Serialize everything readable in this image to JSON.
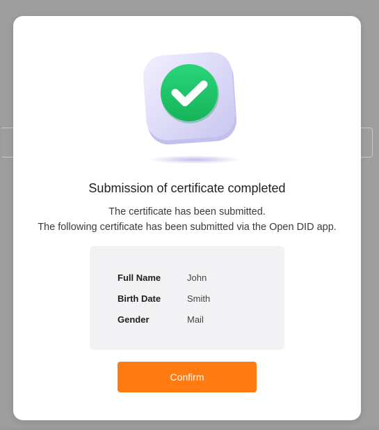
{
  "dialog": {
    "title": "Submission of certificate completed",
    "message_line1": "The certificate has been submitted.",
    "message_line2": "The following certificate has been submitted via the Open DID app.",
    "illustration_icon": "check-badge-icon",
    "fields": [
      {
        "label": "Full Name",
        "value": "John"
      },
      {
        "label": "Birth Date",
        "value": "Smith"
      },
      {
        "label": "Gender",
        "value": "Mail"
      }
    ],
    "confirm_label": "Confirm"
  },
  "colors": {
    "accent": "#ff7a10",
    "check_green": "#1ec46a",
    "card_bg": "#f2f2f4",
    "backdrop": "#9e9e9e"
  }
}
